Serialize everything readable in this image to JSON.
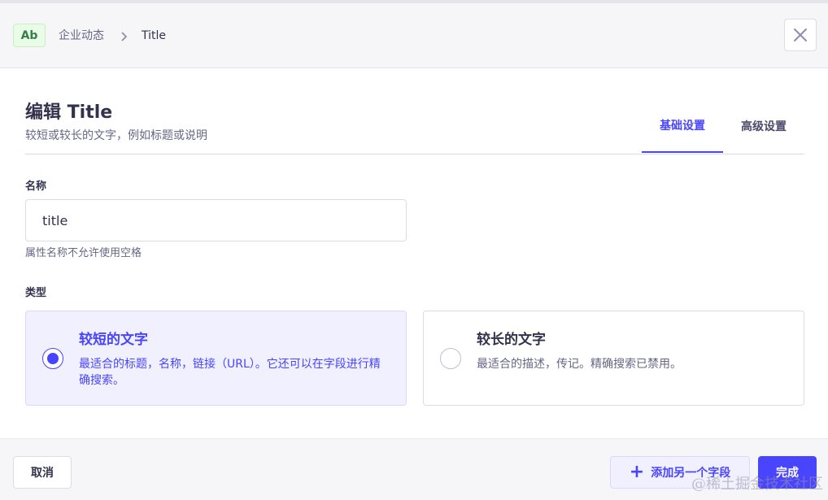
{
  "header": {
    "field_badge": "Ab",
    "breadcrumb_parent": "企业动态",
    "breadcrumb_current": "Title"
  },
  "heading": {
    "title": "编辑 Title",
    "subtitle": "较短或较长的文字，例如标题或说明"
  },
  "tabs": [
    {
      "label": "基础设置",
      "active": true
    },
    {
      "label": "高级设置",
      "active": false
    }
  ],
  "name_field": {
    "label": "名称",
    "value": "title",
    "hint": "属性名称不允许使用空格"
  },
  "type_field": {
    "label": "类型",
    "options": [
      {
        "title": "较短的文字",
        "description": "最适合的标题，名称，链接（URL）。它还可以在字段进行精确搜索。",
        "selected": true
      },
      {
        "title": "较长的文字",
        "description": "最适合的描述，传记。精确搜索已禁用。",
        "selected": false
      }
    ]
  },
  "footer": {
    "cancel_label": "取消",
    "add_another_label": "添加另一个字段",
    "done_label": "完成"
  },
  "watermark": "@稀土掘金技术社区",
  "colors": {
    "accent": "#4945ff",
    "badge_green": "#328048",
    "text_primary": "#32324d",
    "text_secondary": "#666687"
  },
  "icons": {
    "close": "close-icon",
    "chevron": "chevron-right-icon",
    "plus": "plus-icon"
  }
}
